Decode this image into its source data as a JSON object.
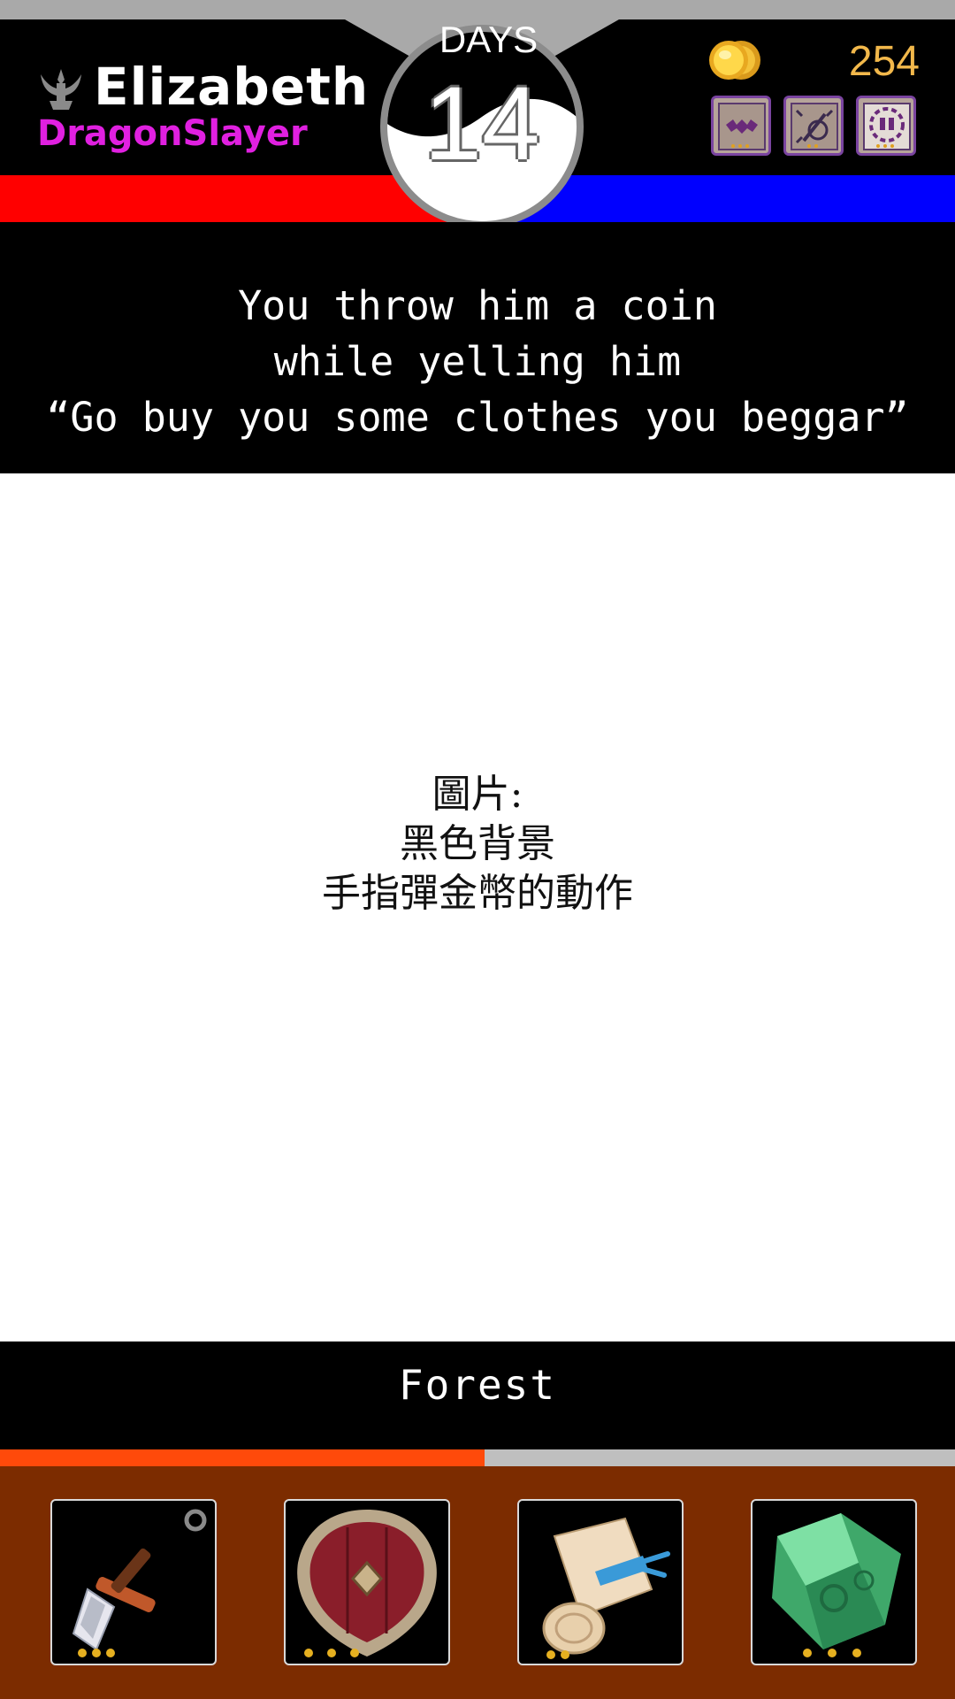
{
  "player": {
    "name": "Elizabeth",
    "title": "DragonSlayer",
    "class_icon": "trident-crown-icon"
  },
  "days": {
    "label": "DAYS",
    "value": "14"
  },
  "gold": {
    "icon": "gold-coin-icon",
    "value": "254"
  },
  "badges": [
    {
      "icon": "bats-card-icon"
    },
    {
      "icon": "broken-sword-card-icon"
    },
    {
      "icon": "gear-potion-card-icon"
    }
  ],
  "stat_bars": {
    "left_color": "#ff0000",
    "right_color": "#0000ff"
  },
  "story": {
    "lines": [
      "You throw him a coin",
      "while yelling him",
      "“Go buy you some clothes you beggar”"
    ]
  },
  "image_placeholder": {
    "lines": [
      "圖片:",
      "黑色背景",
      "手指彈金幣的動作"
    ]
  },
  "location": {
    "name": "Forest",
    "progress": 0.507,
    "progress_color": "#ff4a0a"
  },
  "inventory": [
    {
      "icon": "dagger-icon",
      "stars": 3
    },
    {
      "icon": "shield-icon",
      "stars": 3
    },
    {
      "icon": "scroll-icon",
      "stars": 2
    },
    {
      "icon": "green-crystal-icon",
      "stars": 3
    }
  ]
}
